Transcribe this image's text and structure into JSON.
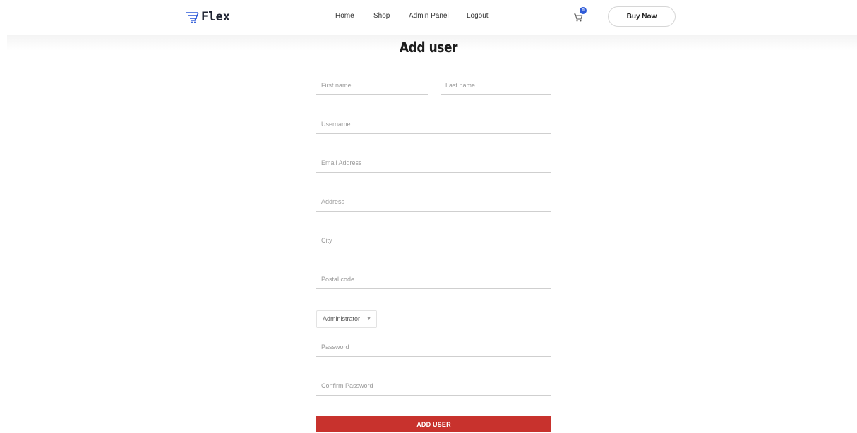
{
  "brand": {
    "name": "Flex",
    "icon": "cart-speed-icon"
  },
  "nav": {
    "items": [
      "Home",
      "Shop",
      "Admin Panel",
      "Logout"
    ]
  },
  "cart": {
    "count": "0",
    "icon": "cart-icon",
    "badge_color": "#2f5bd8"
  },
  "header": {
    "buy_now_label": "Buy Now"
  },
  "page": {
    "title": "Add user"
  },
  "form": {
    "first_name_placeholder": "First name",
    "last_name_placeholder": "Last name",
    "username_placeholder": "Username",
    "email_placeholder": "Email Address",
    "address_placeholder": "Address",
    "city_placeholder": "City",
    "postal_code_placeholder": "Postal code",
    "role_selected": "Administrator",
    "password_placeholder": "Password",
    "confirm_password_placeholder": "Confirm Password",
    "submit_label": "ADD USER",
    "submit_color": "#c8322d"
  }
}
